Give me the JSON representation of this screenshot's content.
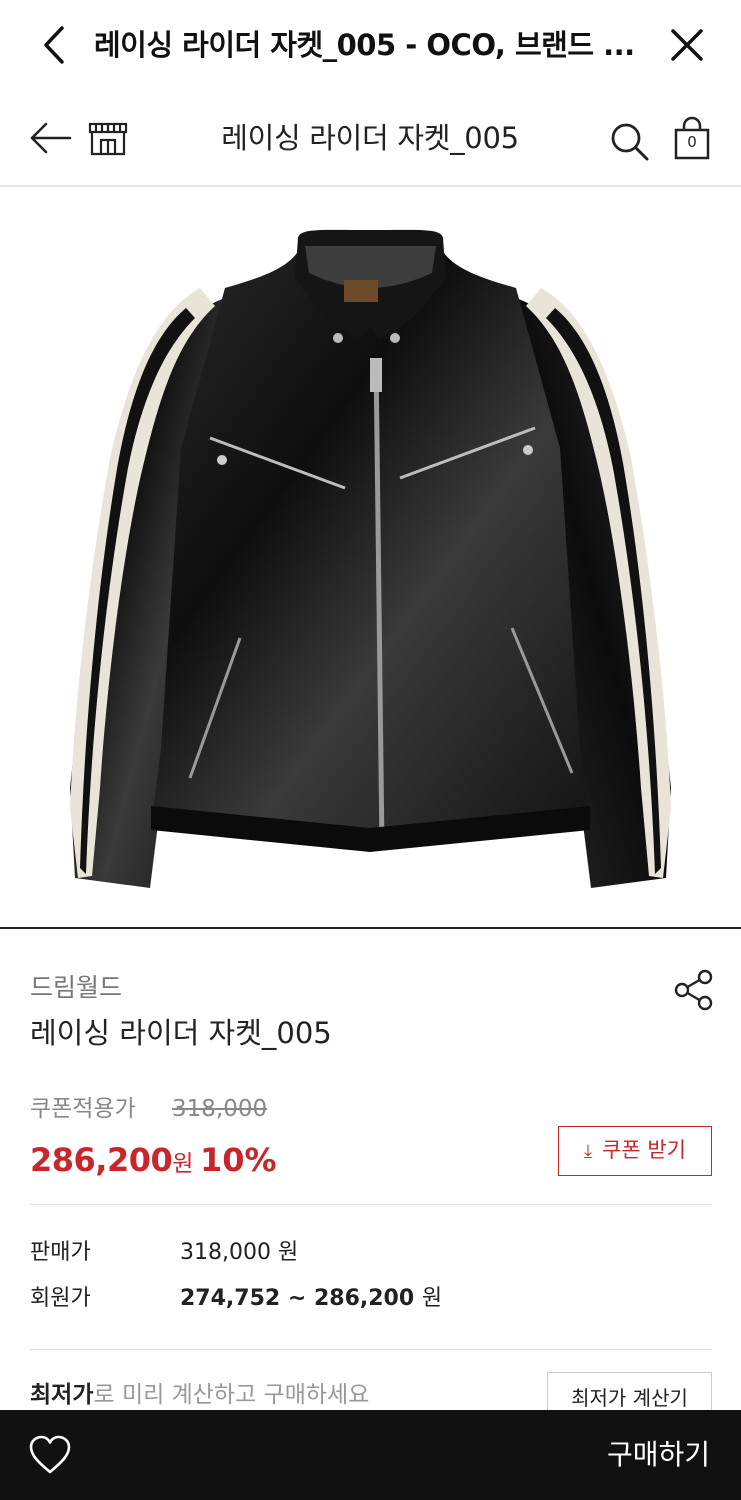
{
  "webview": {
    "title": "레이싱 라이더 자켓_005 - OCO, 브랜드 ..."
  },
  "header": {
    "title": "레이싱 라이더 자켓_005",
    "cart_count": "0"
  },
  "product": {
    "image_alt": "black leather racing rider jacket with white sleeve stripes",
    "brand": "드림월드",
    "name": "레이싱 라이더 자켓_005"
  },
  "coupon": {
    "label": "쿠폰적용가",
    "original_price": "318,000",
    "sale_price": "286,200",
    "sale_unit": "원",
    "discount": "10%",
    "button_label": "쿠폰 받기",
    "button_icon": "download-arrow-icon"
  },
  "prices": {
    "sale_label": "판매가",
    "sale_value": "318,000",
    "sale_unit": "원",
    "member_label": "회원가",
    "member_value": "274,752 ~ 286,200",
    "member_unit": "원"
  },
  "lowest": {
    "strong": "최저가",
    "rest": "로 미리 계산하고 구매하세요",
    "button_label": "최저가 계산기"
  },
  "bottom": {
    "buy_label": "구매하기",
    "wish_icon": "heart-icon"
  },
  "colors": {
    "accent": "#c8262b",
    "bottom_bar": "#111111"
  }
}
